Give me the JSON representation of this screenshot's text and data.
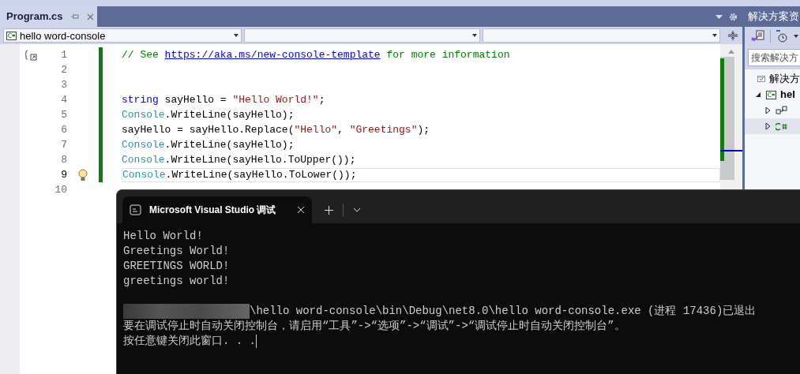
{
  "document_tab": {
    "label": "Program.cs",
    "selected": true
  },
  "nav_bar": {
    "dropdowns": [
      {
        "value": "hello word-console",
        "kind": "project"
      },
      {
        "kind": "empty"
      },
      {
        "kind": "empty"
      }
    ]
  },
  "editor": {
    "lines": [
      {
        "number": "1",
        "changed": true,
        "current": false,
        "tokens": [
          {
            "kind": "comment",
            "text": "// See "
          },
          {
            "kind": "link",
            "text": "https://aka.ms/new-console-template"
          },
          {
            "kind": "comment",
            "text": " for more information"
          }
        ]
      },
      {
        "number": "2",
        "changed": true,
        "current": false
      },
      {
        "number": "3",
        "changed": true,
        "current": false
      },
      {
        "number": "4",
        "changed": true,
        "current": false,
        "tokens": [
          {
            "kind": "keyword",
            "text": "string"
          },
          {
            "kind": "plain",
            "text": " sayHello = "
          },
          {
            "kind": "string",
            "text": "\"Hello World!\""
          },
          {
            "kind": "plain",
            "text": ";"
          }
        ]
      },
      {
        "number": "5",
        "changed": true,
        "current": false,
        "tokens": [
          {
            "kind": "type",
            "text": "Console"
          },
          {
            "kind": "plain",
            "text": ".WriteLine(sayHello);"
          }
        ]
      },
      {
        "number": "6",
        "changed": true,
        "current": false,
        "tokens": [
          {
            "kind": "plain",
            "text": "sayHello = sayHello.Replace("
          },
          {
            "kind": "string",
            "text": "\"Hello\""
          },
          {
            "kind": "plain",
            "text": ", "
          },
          {
            "kind": "string",
            "text": "\"Greetings\""
          },
          {
            "kind": "plain",
            "text": ");"
          }
        ]
      },
      {
        "number": "7",
        "changed": true,
        "current": false,
        "tokens": [
          {
            "kind": "type",
            "text": "Console"
          },
          {
            "kind": "plain",
            "text": ".WriteLine(sayHello);"
          }
        ]
      },
      {
        "number": "8",
        "changed": true,
        "current": false,
        "tokens": [
          {
            "kind": "type",
            "text": "Console"
          },
          {
            "kind": "plain",
            "text": ".WriteLine(sayHello.ToUpper());"
          }
        ]
      },
      {
        "number": "9",
        "changed": true,
        "current": true,
        "tokens": [
          {
            "kind": "type",
            "text": "Console"
          },
          {
            "kind": "plain",
            "text": ".WriteLine(sayHello.ToLower());"
          }
        ]
      },
      {
        "number": "10",
        "changed": false,
        "current": false
      }
    ]
  },
  "solution_explorer": {
    "title": "解决方案资",
    "search": {
      "placeholder": "搜索解决方"
    },
    "tree": [
      {
        "label": "解决方",
        "kind": "solution",
        "children": [
          {
            "label": "hel",
            "kind": "project",
            "expanded": true,
            "selected": false,
            "children": [
              {
                "kind": "dependencies",
                "expanded": false,
                "selected": false
              },
              {
                "kind": "csharp-file",
                "expanded": false,
                "selected": true
              }
            ]
          }
        ]
      }
    ]
  },
  "console": {
    "tab": {
      "title": "Microsoft Visual Studio 调试",
      "selected": true
    },
    "output": [
      {
        "kind": "text",
        "text": "Hello World!"
      },
      {
        "kind": "text",
        "text": "Greetings World!"
      },
      {
        "kind": "text",
        "text": "GREETINGS WORLD!"
      },
      {
        "kind": "text",
        "text": "greetings world!"
      },
      {
        "kind": "blank"
      },
      {
        "kind": "redacted",
        "text": "\\hello word-console\\bin\\Debug\\net8.0\\hello word-console.exe (进程 17436)已退出"
      },
      {
        "kind": "text",
        "text": "要在调试停止时自动关闭控制台，请启用“工具”->“选项”->“调试”->“调试停止时自动关闭控制台”。"
      },
      {
        "kind": "prompt",
        "text": "按任意键关闭此窗口. . ."
      }
    ]
  }
}
